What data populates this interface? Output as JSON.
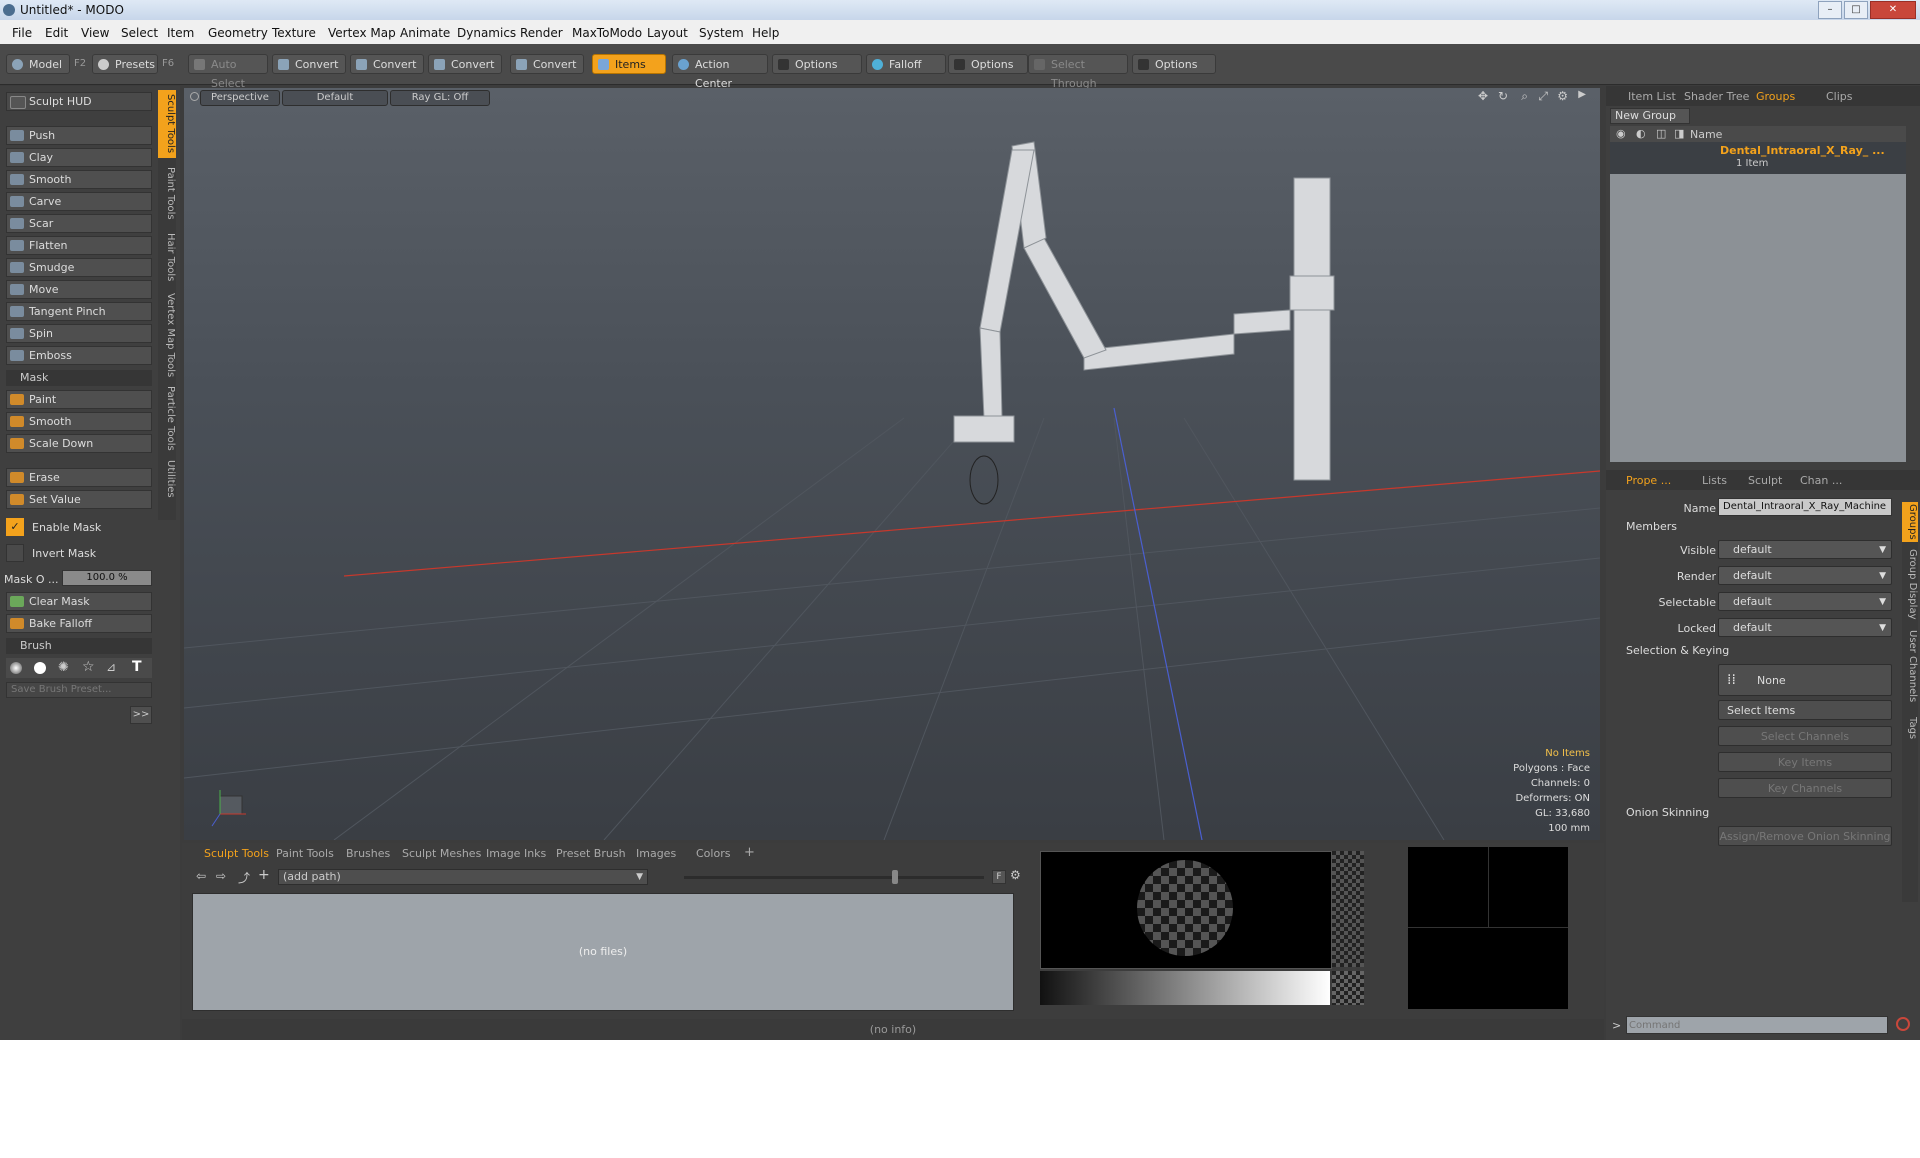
{
  "window": {
    "title": "Untitled* - MODO",
    "controls": [
      "–",
      "□",
      "✕"
    ]
  },
  "menu": [
    "File",
    "Edit",
    "View",
    "Select",
    "Item",
    "Geometry",
    "Texture",
    "Vertex Map",
    "Animate",
    "Dynamics",
    "Render",
    "MaxToModo",
    "Layout",
    "System",
    "Help"
  ],
  "toolbar": {
    "model": "Model",
    "model_key": "F2",
    "presets": "Presets",
    "presets_key": "F6",
    "auto_select": "Auto Select",
    "convert": "Convert",
    "items": "Items",
    "action_center": "Action Center",
    "options": "Options",
    "falloff": "Falloff",
    "select_through": "Select Through"
  },
  "left": {
    "hud": "Sculpt HUD",
    "sculpt_tools": [
      "Push",
      "Clay",
      "Smooth",
      "Carve",
      "Scar",
      "Flatten",
      "Smudge",
      "Move",
      "Tangent Pinch",
      "Spin",
      "Emboss"
    ],
    "mask_header": "Mask",
    "mask_tools": [
      "Paint",
      "Smooth",
      "Scale Down"
    ],
    "erase": "Erase",
    "set_value": "Set Value",
    "enable_mask": "Enable Mask",
    "invert_mask": "Invert Mask",
    "mask_opacity_label": "Mask O ...",
    "mask_opacity_value": "100.0 %",
    "clear_mask": "Clear Mask",
    "bake_falloff": "Bake Falloff",
    "brush_header": "Brush",
    "save_brush_preset": "Save Brush Preset...",
    "expand": ">>",
    "vtabs": [
      "Sculpt Tools",
      "Paint Tools",
      "Hair Tools",
      "Vertex Map Tools",
      "Particle Tools",
      "Utilities"
    ]
  },
  "viewport": {
    "perspective": "Perspective",
    "shading": "Default",
    "raygl": "Ray GL: Off",
    "stats": [
      "No Items",
      "Polygons : Face",
      "Channels: 0",
      "Deformers: ON",
      "GL: 33,680",
      "100 mm"
    ]
  },
  "bottom": {
    "tabs": [
      "Sculpt Tools",
      "Paint Tools",
      "Brushes",
      "Sculpt Meshes",
      "Image Inks",
      "Preset Brush",
      "Images",
      "Colors"
    ],
    "add_tab": "+",
    "path": "(add path)",
    "filter": "F",
    "no_files": "(no files)",
    "info": "(no info)"
  },
  "right": {
    "top_tabs": [
      "Item List",
      "Shader Tree",
      "Groups",
      "Clips"
    ],
    "new_group": "New Group",
    "name_header": "Name",
    "group_name": "Dental_Intraoral_X_Ray_ ...",
    "group_count": "1 Item",
    "prop_tabs": [
      "Prope ...",
      "Lists",
      "Sculpt",
      "Chan ..."
    ],
    "name_label": "Name",
    "name_value": "Dental_Intraoral_X_Ray_Machine",
    "members": "Members",
    "visible_label": "Visible",
    "visible": "default",
    "render_label": "Render",
    "render": "default",
    "selectable_label": "Selectable",
    "selectable": "default",
    "locked_label": "Locked",
    "locked": "default",
    "sel_keying": "Selection & Keying",
    "none": "None",
    "select_items": "Select Items",
    "select_channels": "Select Channels",
    "key_items": "Key Items",
    "key_channels": "Key Channels",
    "onion": "Onion Skinning",
    "assign_onion": "Assign/Remove Onion Skinning",
    "side_tabs": [
      "Groups",
      "Group Display",
      "User Channels",
      "Tags"
    ],
    "command_placeholder": "Command",
    "prompt": ">"
  },
  "colors": {
    "accent": "#f3a21c",
    "group_name": "#f3a21c",
    "x_axis": "#c8382c",
    "z_axis": "#4a5fd0"
  }
}
